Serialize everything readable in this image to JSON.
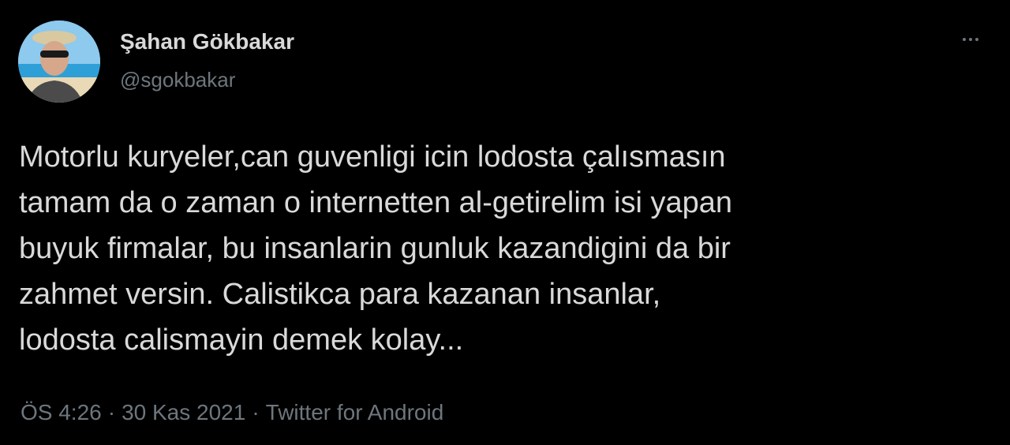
{
  "author": {
    "display_name": "Şahan Gökbakar",
    "handle": "@sgokbakar",
    "avatar_icon": "profile-photo"
  },
  "more_icon": "more-options-icon",
  "tweet": {
    "lines": [
      "Motorlu kuryeler,can guvenligi icin lodosta çalısmasın",
      "tamam da o zaman o internetten al-getirelim isi yapan",
      "buyuk firmalar, bu insanlarin gunluk kazandigini da bir",
      "zahmet versin. Calistikca para kazanan insanlar,",
      "lodosta calismayin demek kolay..."
    ]
  },
  "meta": {
    "time": "ÖS 4:26",
    "separator": "·",
    "date": "30 Kas 2021",
    "source": "Twitter for Android"
  },
  "colors": {
    "background": "#000000",
    "primary_text": "#d9d9d9",
    "secondary_text": "#6e767d"
  }
}
